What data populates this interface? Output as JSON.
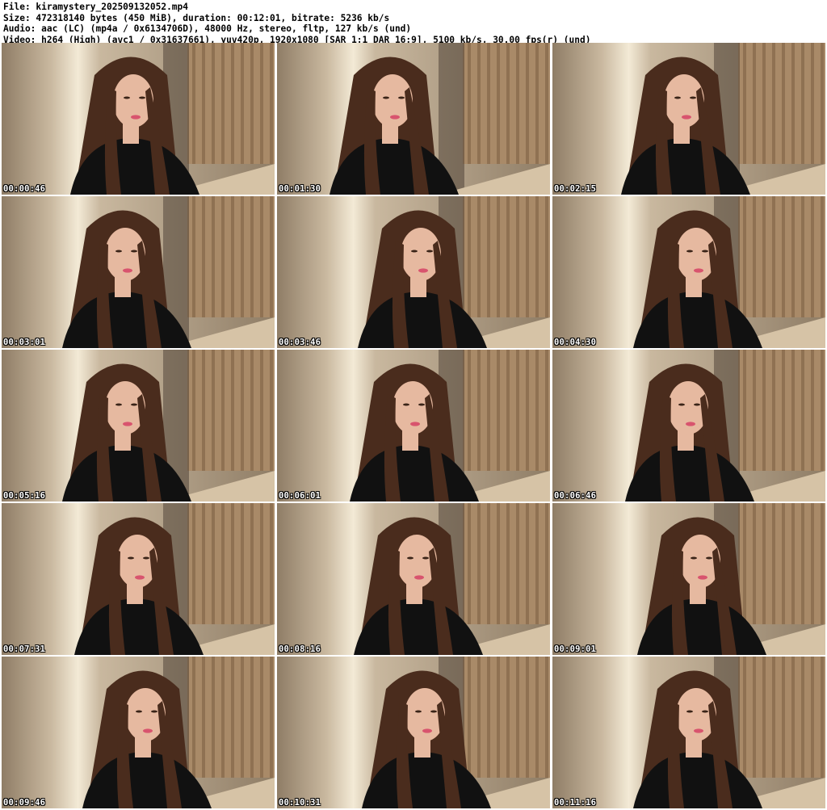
{
  "header": {
    "file_line": "File: kiramystery_2025091320 52.mp4",
    "size_line": "Size: 472318140 bytes (450 MiB), duration: 00:12:01, bitrate: 5236 kb/s",
    "audio_line": "Audio: aac (LC) (mp4a / 0x6134706D), 48000 Hz, stereo, fltp, 127 kb/s (und)",
    "video_line": "Video: h264 (High) (avc1 / 0x31637661), yuv420p, 1920x1080 [SAR 1:1 DAR 16:9], 5100 kb/s, 30.00 fps(r) (und)"
  },
  "thumbnails": [
    {
      "timestamp": "00:00:46"
    },
    {
      "timestamp": "00:01:30"
    },
    {
      "timestamp": "00:02:15"
    },
    {
      "timestamp": "00:03:01"
    },
    {
      "timestamp": "00:03:46"
    },
    {
      "timestamp": "00:04:30"
    },
    {
      "timestamp": "00:05:16"
    },
    {
      "timestamp": "00:06:01"
    },
    {
      "timestamp": "00:06:46"
    },
    {
      "timestamp": "00:07:31"
    },
    {
      "timestamp": "00:08:16"
    },
    {
      "timestamp": "00:09:01"
    },
    {
      "timestamp": "00:09:46"
    },
    {
      "timestamp": "00:10:31"
    },
    {
      "timestamp": "00:11:16"
    }
  ],
  "colors": {
    "wall": "#c9b89f",
    "wall_shadow": "#8f7d66",
    "window_light": "#f3ead6",
    "wood_panel": "#a98a68",
    "wood_slat": "#7a5d40",
    "hair": "#4a2c1d",
    "skin": "#e6b9a0",
    "shirt": "#111111",
    "desk": "#d6c3a6"
  }
}
